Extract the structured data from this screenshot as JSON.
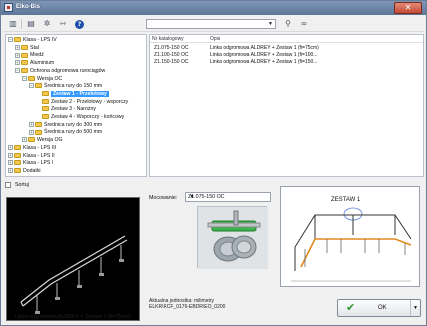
{
  "window": {
    "title": "Elko-Bis",
    "close_glyph": "✕"
  },
  "toolbar": {
    "combo_value": "",
    "icons": [
      "layout-grid-icon",
      "list-icon",
      "tools-icon",
      "pipe-arrows-icon",
      "help-icon",
      "search-icon",
      "binoculars-icon"
    ]
  },
  "tree": {
    "items": [
      {
        "label": "Klasa - LPS IV",
        "expander": "−",
        "level": 0
      },
      {
        "label": "Stal",
        "expander": "+",
        "level": 1
      },
      {
        "label": "Miedź",
        "expander": "+",
        "level": 1
      },
      {
        "label": "Aluminium",
        "expander": "+",
        "level": 1
      },
      {
        "label": "Ochrona odgromowa rurociągów",
        "expander": "−",
        "level": 1
      },
      {
        "label": "Wersja OC",
        "expander": "−",
        "level": 2
      },
      {
        "label": "Średnica rury do 150 mm",
        "expander": "−",
        "level": 3
      },
      {
        "label": "Zestaw 1 - Przelotowy",
        "expander": "",
        "level": 4,
        "selected": true
      },
      {
        "label": "Zestaw 2 - Przelotowy - wsporczy",
        "expander": "",
        "level": 4
      },
      {
        "label": "Zestaw 3 - Narożny",
        "expander": "",
        "level": 4
      },
      {
        "label": "Zestaw 4 - Wsporczy - końcowy",
        "expander": "",
        "level": 4
      },
      {
        "label": "Średnica rury do 300 mm",
        "expander": "+",
        "level": 3
      },
      {
        "label": "Średnica rury do 500 mm",
        "expander": "+",
        "level": 3
      },
      {
        "label": "Wersja OG",
        "expander": "+",
        "level": 2
      },
      {
        "label": "Klasa - LPS III",
        "expander": "+",
        "level": 0
      },
      {
        "label": "Klasa - LPS II",
        "expander": "+",
        "level": 0
      },
      {
        "label": "Klasa - LPS I",
        "expander": "+",
        "level": 0
      },
      {
        "label": "Dodatki",
        "expander": "+",
        "level": 0
      }
    ]
  },
  "list": {
    "headers": {
      "catalog": "Nr katalogowy",
      "desc": "Opis"
    },
    "rows": [
      {
        "catalog": "Z1.075-150 OC",
        "desc": "Linka odgromowa ALDREY + Zestaw 1 (fi=75cm)"
      },
      {
        "catalog": "Z1.100-150 OC",
        "desc": "Linka odgromowa ALDREY + Zestaw 1 (fi=100..."
      },
      {
        "catalog": "Z1.150-150 OC",
        "desc": "Linka odgromowa ALDREY + Zestaw 1 (fi=150..."
      }
    ]
  },
  "sort": {
    "label": "Sortuj"
  },
  "preview": {
    "caption": "Linka odgromowa ALDREY + Zestaw 1 (fi=75cm)"
  },
  "mounting": {
    "label": "Mocowanie:",
    "value": "Z1.075-150 OC"
  },
  "drawing": {
    "label": "ZESTAW 1"
  },
  "units": {
    "line1": "Aktualna jednostka: milimetry",
    "line2": "ELKR\\KCF_0176-EBDR\\EO_0200"
  },
  "ok": {
    "label": "OK",
    "check_glyph": "✔",
    "drop_glyph": "▼"
  },
  "colors": {
    "selection": "#3399ff",
    "folder": "#f2c94c",
    "pipe_orange": "#e08a1e",
    "accent_green": "#2e9b2e"
  }
}
